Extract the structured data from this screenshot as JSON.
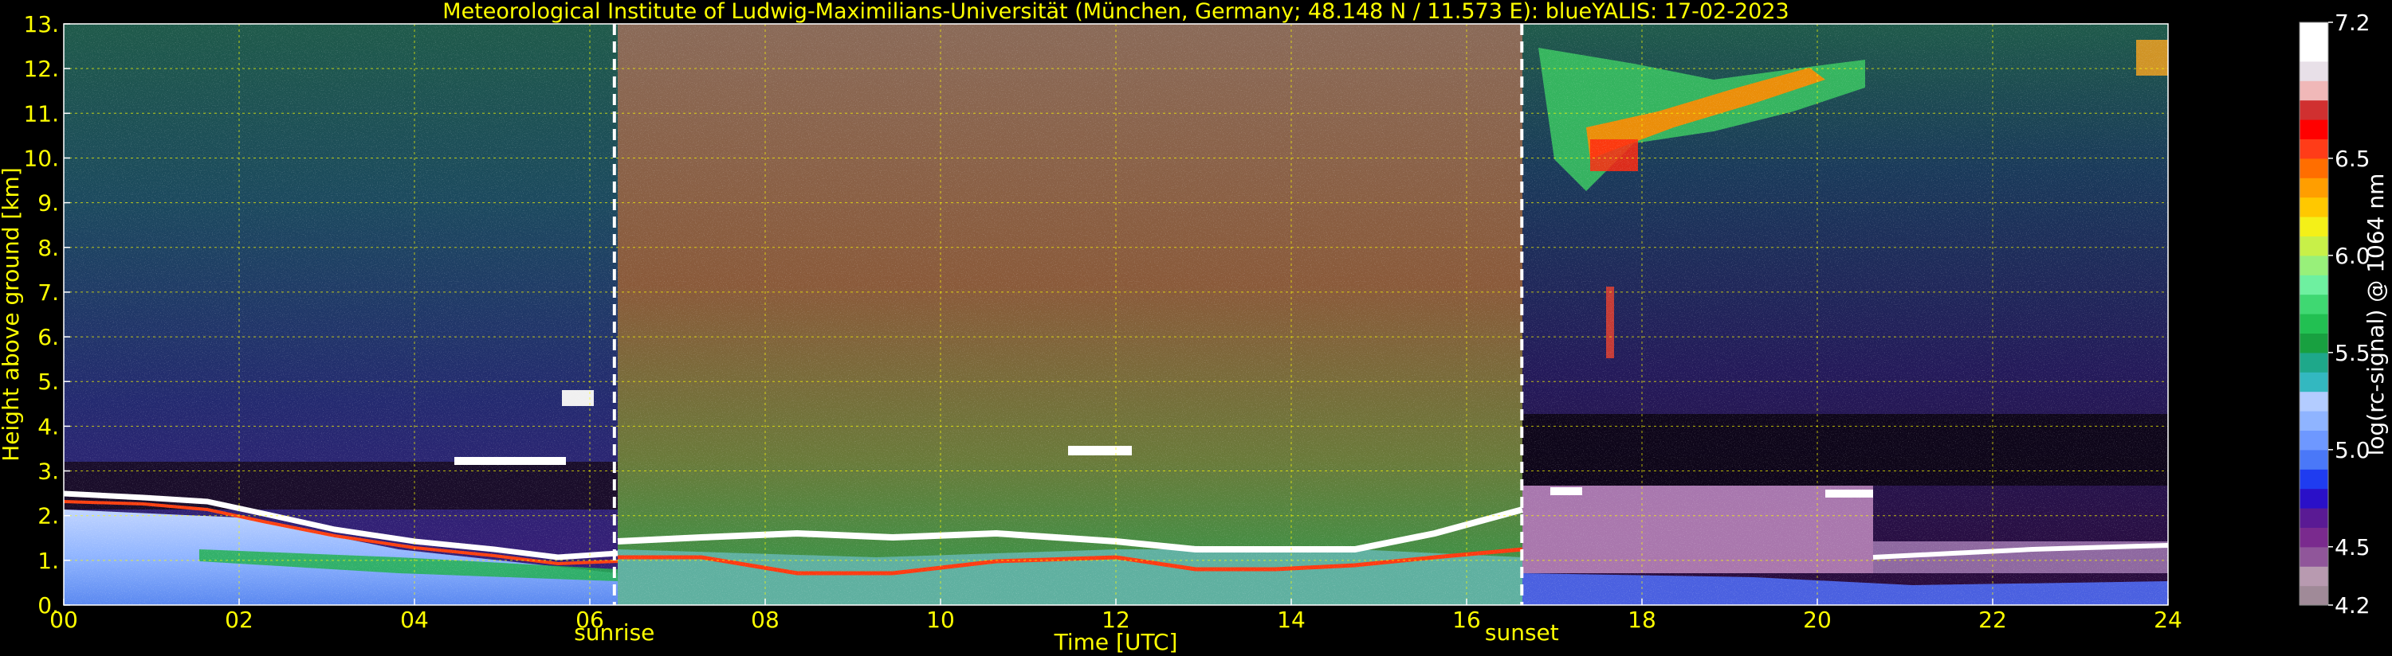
{
  "chart_data": {
    "type": "heatmap",
    "title": "Meteorological Institute of Ludwig-Maximilians-Universität (München, Germany; 48.148 N / 11.573 E):     blueYALIS: 17-02-2023",
    "xlabel": "Time [UTC]",
    "ylabel": "Height above ground [km]",
    "xlim": [
      0,
      24
    ],
    "ylim": [
      0,
      13
    ],
    "x_ticks": [
      0,
      2,
      4,
      6,
      8,
      10,
      12,
      14,
      16,
      18,
      20,
      22,
      24
    ],
    "x_tick_labels": [
      "00",
      "02",
      "04",
      "06",
      "08",
      "10",
      "12",
      "14",
      "16",
      "18",
      "20",
      "22",
      "24"
    ],
    "y_ticks": [
      0,
      1,
      2,
      3,
      4,
      5,
      6,
      7,
      8,
      9,
      10,
      11,
      12,
      13
    ],
    "y_tick_labels": [
      "0.",
      "1.",
      "2.",
      "3.",
      "4.",
      "5.",
      "6.",
      "7.",
      "8.",
      "9.",
      "10.",
      "11.",
      "12.",
      "13."
    ],
    "grid": true,
    "events": [
      {
        "label": "sunrise",
        "x": 6.28
      },
      {
        "label": "sunset",
        "x": 16.63
      }
    ],
    "colorbar": {
      "label": "log(rc-signal) @ 1064 nm",
      "range": [
        4.2,
        7.2
      ],
      "tick_values": [
        4.2,
        4.5,
        5.0,
        5.5,
        6.0,
        6.5,
        7.2
      ],
      "tick_labels": [
        "4.2",
        "4.5",
        "5.0",
        "5.5",
        "6.0",
        "6.5",
        "7.2"
      ],
      "colors": [
        "#a08a98",
        "#b89ab0",
        "#90569a",
        "#7a2a8e",
        "#5a1a94",
        "#2a10c8",
        "#1f3cf0",
        "#4a78f8",
        "#6e98ff",
        "#8fb4ff",
        "#b3ccff",
        "#33b8c0",
        "#1ea88a",
        "#18a040",
        "#22c052",
        "#3fd872",
        "#6ef0a0",
        "#98f07a",
        "#c8f048",
        "#f4f018",
        "#ffc800",
        "#ff9e00",
        "#ff6e00",
        "#ff3c18",
        "#ff0000",
        "#d03030",
        "#f0b8b8",
        "#e8e0e8",
        "#ffffff",
        "#ffffff"
      ]
    }
  }
}
